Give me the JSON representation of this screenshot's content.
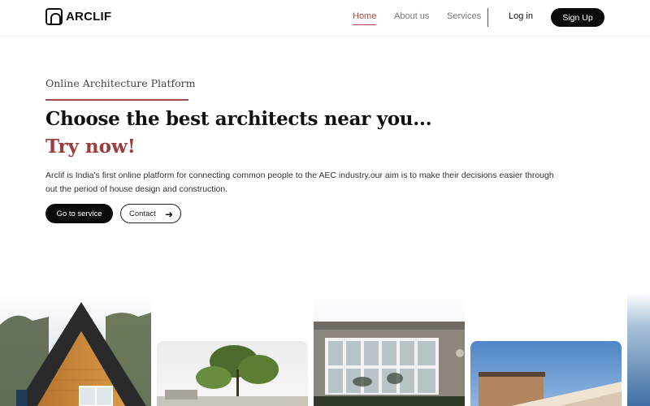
{
  "brand": {
    "name": "ARCLIF"
  },
  "nav": {
    "links": [
      "Home",
      "About us",
      "Services"
    ],
    "login": "Log in",
    "signup": "Sign Up"
  },
  "hero": {
    "eyebrow": "Online Architecture Platform",
    "title": "Choose the best architects near you...",
    "subtitle": "Try now!",
    "description": "Arclif is India's first online platform for connecting common people to the AEC industry.our aim is to make their decisions easier through out the period of house design and construction.",
    "primary_cta": "Go to service",
    "secondary_cta": "Contact"
  },
  "colors": {
    "accent": "#a34a4a",
    "dark": "#0b0b0b"
  }
}
